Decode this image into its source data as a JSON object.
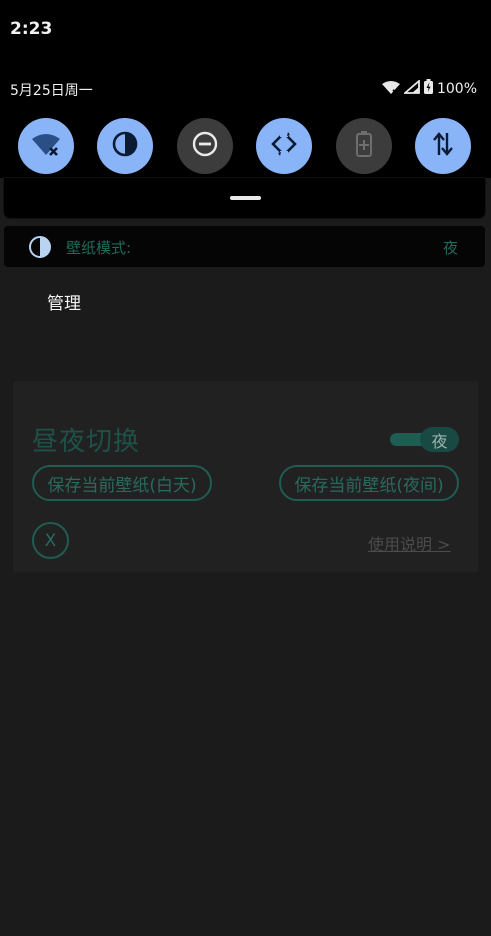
{
  "status_bar": {
    "time": "2:23",
    "date": "5月25日周一",
    "battery": "100%"
  },
  "quick_settings": [
    {
      "name": "wifi-off",
      "state": "on"
    },
    {
      "name": "dark-theme",
      "state": "on"
    },
    {
      "name": "do-not-disturb",
      "state": "off"
    },
    {
      "name": "auto-rotate",
      "state": "on"
    },
    {
      "name": "battery-saver",
      "state": "disabled"
    },
    {
      "name": "mobile-data",
      "state": "on"
    }
  ],
  "mode_bar": {
    "label": "壁纸模式:",
    "value": "夜"
  },
  "manage_label": "管理",
  "card": {
    "title": "昼夜切换",
    "toggle_value": "夜",
    "save_day": "保存当前壁纸(白天)",
    "save_night": "保存当前壁纸(夜间)",
    "close": "X",
    "help": "使用说明 >"
  },
  "colors": {
    "accent_tile": "#8ab4f8",
    "teal": "#1f5c52"
  }
}
